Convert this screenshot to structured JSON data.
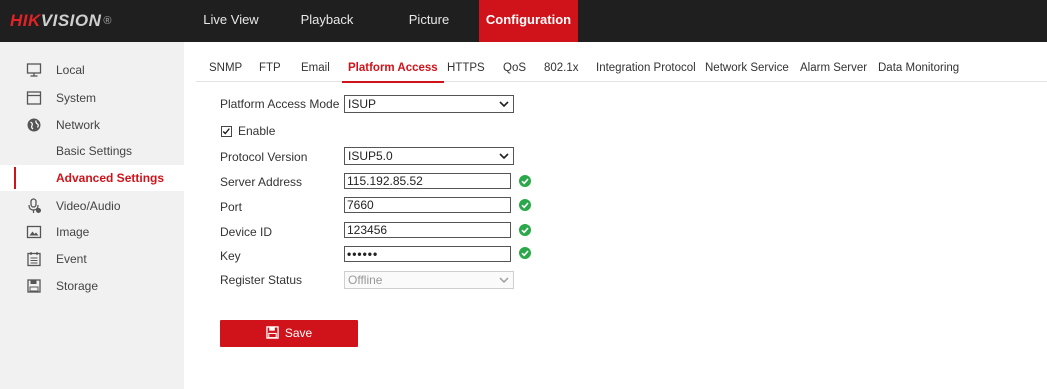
{
  "brand": {
    "part1": "HIK",
    "part2": "VISION",
    "reg": "®"
  },
  "topnav": {
    "live_view": "Live View",
    "playback": "Playback",
    "picture": "Picture",
    "configuration": "Configuration"
  },
  "sidebar": {
    "local": "Local",
    "system": "System",
    "network": "Network",
    "basic_settings": "Basic Settings",
    "advanced_settings": "Advanced Settings",
    "video_audio": "Video/Audio",
    "image": "Image",
    "event": "Event",
    "storage": "Storage"
  },
  "tabs": {
    "snmp": "SNMP",
    "ftp": "FTP",
    "email": "Email",
    "platform_access": "Platform Access",
    "https": "HTTPS",
    "qos": "QoS",
    "dot1x": "802.1x",
    "integration_protocol": "Integration Protocol",
    "network_service": "Network Service",
    "alarm_server": "Alarm Server",
    "data_monitoring": "Data Monitoring"
  },
  "form": {
    "platform_access_mode": {
      "label": "Platform Access Mode",
      "value": "ISUP"
    },
    "enable": {
      "label": "Enable",
      "checked": true
    },
    "protocol_version": {
      "label": "Protocol Version",
      "value": "ISUP5.0"
    },
    "server_address": {
      "label": "Server Address",
      "value": "115.192.85.52"
    },
    "port": {
      "label": "Port",
      "value": "7660"
    },
    "device_id": {
      "label": "Device ID",
      "value": "123456"
    },
    "key": {
      "label": "Key",
      "value": "••••••"
    },
    "register_status": {
      "label": "Register Status",
      "value": "Offline"
    }
  },
  "save_label": "Save",
  "colors": {
    "accent": "#d0131a",
    "topbar": "#1f1f1f",
    "valid": "#2aa84a"
  }
}
